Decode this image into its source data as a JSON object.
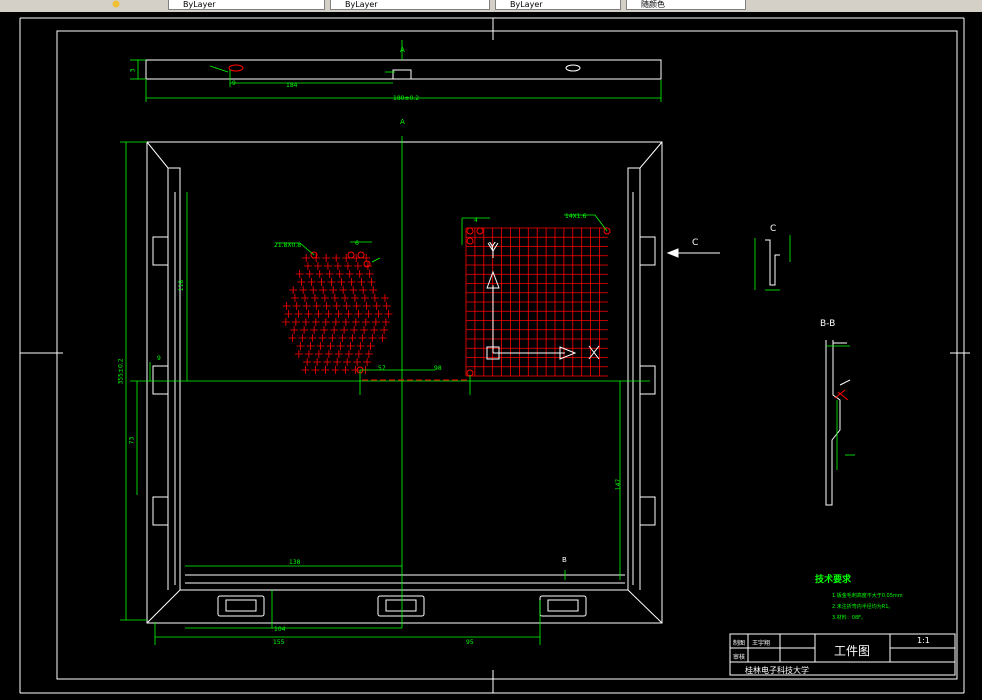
{
  "toolbar": {
    "tabs": [
      {
        "label": "ByLayer"
      },
      {
        "label": "ByLayer"
      },
      {
        "label": "ByLayer"
      },
      {
        "label": "随颜色"
      }
    ]
  },
  "drawing": {
    "dims": {
      "top_width": "180±0.2",
      "top_left": "184",
      "top_height": "3",
      "top_small": "9",
      "left_height": "118",
      "left_total": "355±0.2",
      "left_lower": "73",
      "left_small": "9",
      "right_lower": "147",
      "bottom_left": "138",
      "bottom_mid_a": "155",
      "bottom_mid_b": "95",
      "bottom_small": "104",
      "mid_57": "57",
      "mid_98": "98",
      "hex_label": "21.8X0.8",
      "grid_label": "14X1.6",
      "grid_dim_a": "4",
      "hex_dim_a": "6"
    },
    "markers": {
      "section_A_top": "A",
      "section_A_bottom": "B",
      "view_C": "C",
      "view_C_title": "C",
      "view_BB_title": "B-B",
      "axis_x": "X",
      "axis_y": "Y"
    },
    "notes": {
      "title": "技术要求",
      "items": [
        "1.钣金毛刺高度不大于0.05mm",
        "2.未注折弯内半径均为R1。",
        "3.材料：08F。"
      ]
    },
    "title_block": {
      "design_label": "制图",
      "designer": "王宇翔",
      "check_label": "审核",
      "drawing_name": "工件图",
      "scale": "1:1",
      "school": "桂林电子科技大学"
    }
  }
}
